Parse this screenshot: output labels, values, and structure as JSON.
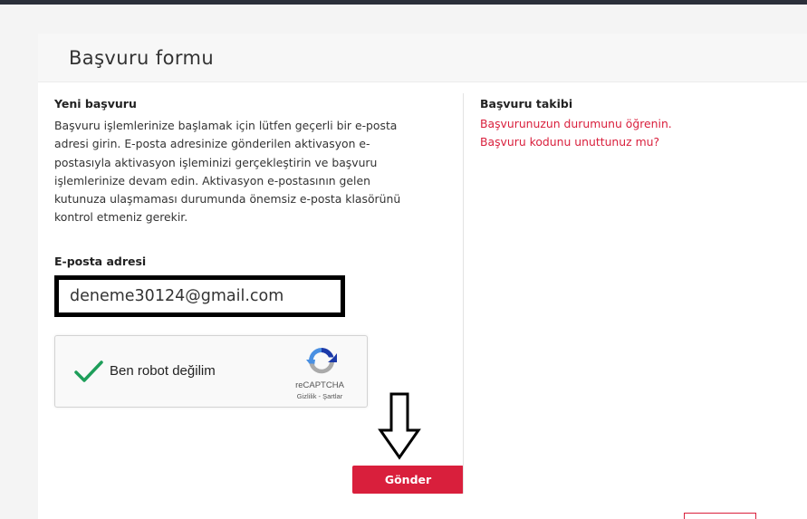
{
  "page": {
    "title": "Başvuru formu"
  },
  "new_application": {
    "heading": "Yeni başvuru",
    "intro_lines": [
      "Başvuru işlemlerinize başlamak için lütfen geçerli bir e-posta",
      "adresi girin. E-posta adresinize gönderilen aktivasyon e-",
      "postasıyla aktivasyon işleminizi gerçekleştirin ve başvuru",
      "işlemlerinize devam edin. Aktivasyon e-postasının gelen",
      "kutunuza ulaşmaması durumunda önemsiz e-posta klasörünü",
      "kontrol etmeniz gerekir."
    ],
    "email_label": "E-posta adresi",
    "email_value": "deneme30124@gmail.com",
    "submit_label": "Gönder"
  },
  "captcha": {
    "label": "Ben robot değilim",
    "brand": "reCAPTCHA",
    "terms": "Gizlilik - Şartlar",
    "checked": true
  },
  "tracking": {
    "heading": "Başvuru takibi",
    "links": [
      "Başvurunuzun durumunu öğrenin.",
      "Başvuru kodunu unuttunuz mu?"
    ]
  },
  "colors": {
    "accent": "#d91f3c",
    "check": "#1e9e5a",
    "topbar": "#2b2f3a"
  },
  "icons": {
    "check": "checkmark-icon",
    "captcha_logo": "recaptcha-logo-icon",
    "annotation": "down-arrow-icon"
  }
}
